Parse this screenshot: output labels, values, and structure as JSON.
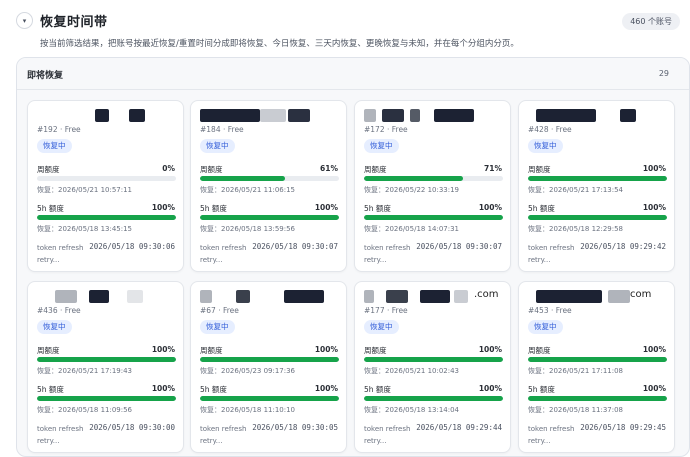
{
  "header": {
    "collapse_glyph": "▾",
    "title": "恢复时间带",
    "count_pill": "460 个账号",
    "description": "按当前筛选结果，把账号按最近恢复/重置时间分成即将恢复、今日恢复、三天内恢复、更晚恢复与未知，并在每个分组内分页。"
  },
  "group": {
    "title": "即将恢复",
    "count": "29"
  },
  "labels": {
    "weekly": "周额度",
    "five_hour": "5h 额度",
    "status": "恢复中",
    "footer_a": "token refresh",
    "footer_b": "retry..."
  },
  "colors": {
    "bar": "#16a34a",
    "badge_bg": "#e6eeff",
    "badge_text": "#2f5bd8"
  },
  "cards": [
    {
      "acct_suffix": "",
      "meta": "#192 · Free",
      "weekly_pct": "0%",
      "weekly_value": 0,
      "weekly_reset": "恢复：2026/05/21 10:57:11",
      "five_pct": "100%",
      "five_value": 100,
      "five_reset": "恢复：2026/05/18 13:45:15",
      "refresh_time": "2026/05/18 09:30:06"
    },
    {
      "acct_suffix": "",
      "meta": "#184 · Free",
      "weekly_pct": "61%",
      "weekly_value": 61,
      "weekly_reset": "恢复：2026/05/21 11:06:15",
      "five_pct": "100%",
      "five_value": 100,
      "five_reset": "恢复：2026/05/18 13:59:56",
      "refresh_time": "2026/05/18 09:30:07"
    },
    {
      "acct_suffix": "",
      "meta": "#172 · Free",
      "weekly_pct": "71%",
      "weekly_value": 71,
      "weekly_reset": "恢复：2026/05/22 10:33:19",
      "five_pct": "100%",
      "five_value": 100,
      "five_reset": "恢复：2026/05/18 14:07:31",
      "refresh_time": "2026/05/18 09:30:07"
    },
    {
      "acct_suffix": "",
      "meta": "#428 · Free",
      "weekly_pct": "100%",
      "weekly_value": 100,
      "weekly_reset": "恢复：2026/05/21 17:13:54",
      "five_pct": "100%",
      "five_value": 100,
      "five_reset": "恢复：2026/05/18 12:29:58",
      "refresh_time": "2026/05/18 09:29:42"
    },
    {
      "acct_suffix": "",
      "meta": "#436 · Free",
      "weekly_pct": "100%",
      "weekly_value": 100,
      "weekly_reset": "恢复：2026/05/21 17:19:43",
      "five_pct": "100%",
      "five_value": 100,
      "five_reset": "恢复：2026/05/18 11:09:56",
      "refresh_time": "2026/05/18 09:30:00"
    },
    {
      "acct_suffix": "",
      "meta": "#67 · Free",
      "weekly_pct": "100%",
      "weekly_value": 100,
      "weekly_reset": "恢复：2026/05/23 09:17:36",
      "five_pct": "100%",
      "five_value": 100,
      "five_reset": "恢复：2026/05/18 11:10:10",
      "refresh_time": "2026/05/18 09:30:05"
    },
    {
      "acct_suffix": ".com",
      "meta": "#177 · Free",
      "weekly_pct": "100%",
      "weekly_value": 100,
      "weekly_reset": "恢复：2026/05/21 10:02:43",
      "five_pct": "100%",
      "five_value": 100,
      "five_reset": "恢复：2026/05/18 13:14:04",
      "refresh_time": "2026/05/18 09:29:44"
    },
    {
      "acct_suffix": "com",
      "meta": "#453 · Free",
      "weekly_pct": "100%",
      "weekly_value": 100,
      "weekly_reset": "恢复：2026/05/21 17:11:08",
      "five_pct": "100%",
      "five_value": 100,
      "five_reset": "恢复：2026/05/18 11:37:08",
      "refresh_time": "2026/05/18 09:29:45"
    }
  ]
}
